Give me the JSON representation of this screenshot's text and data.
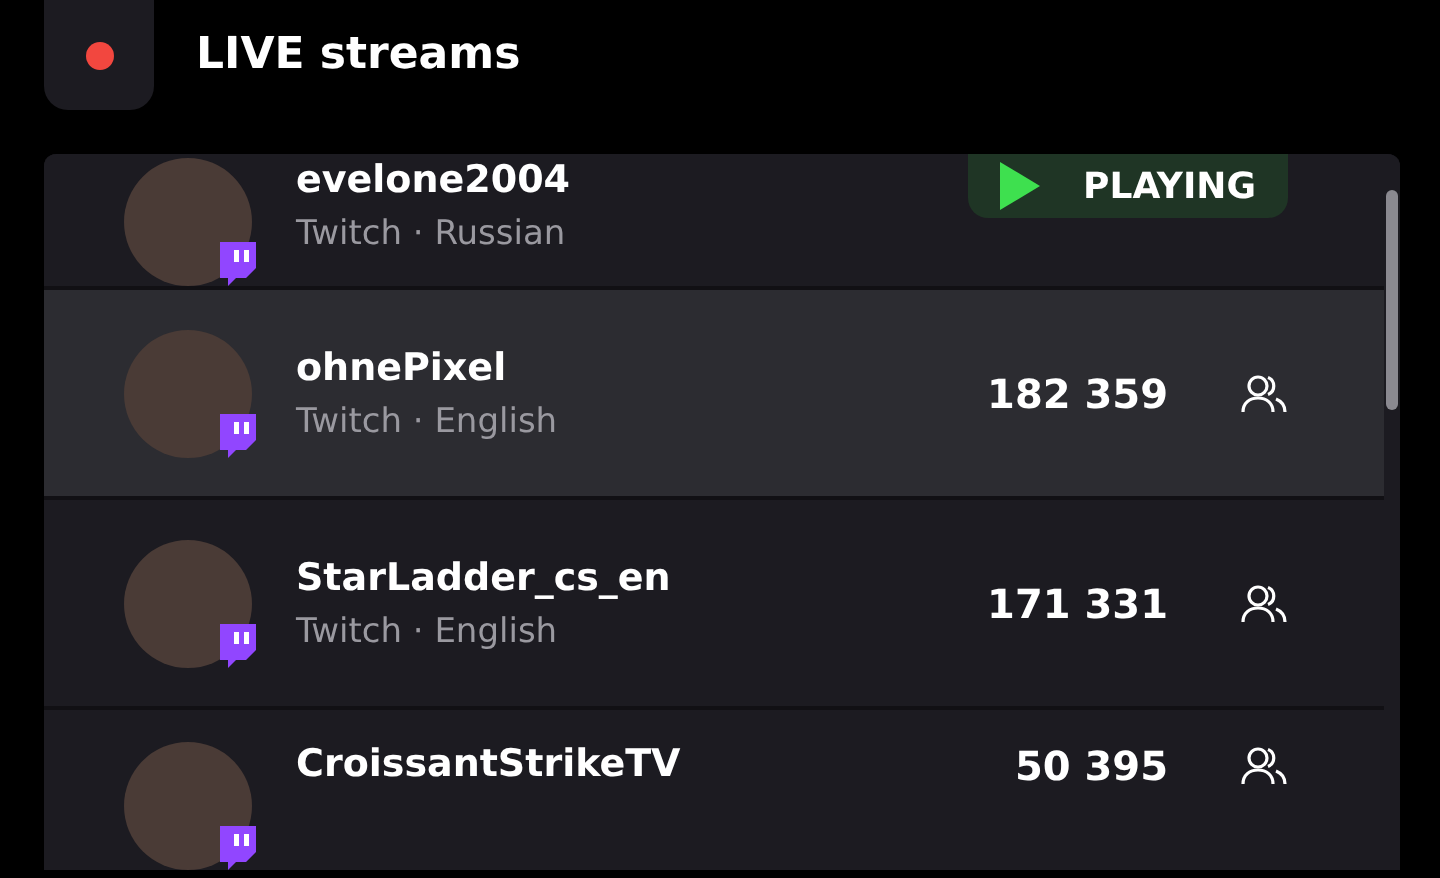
{
  "header": {
    "title": "LIVE streams"
  },
  "streams": [
    {
      "kind": "playing",
      "name": "evelone2004",
      "subtitle": "Twitch · Russian",
      "status": "PLAYING",
      "selected": false
    },
    {
      "kind": "viewers",
      "name": "ohnePixel",
      "subtitle": "Twitch · English",
      "viewers": "182 359",
      "selected": true
    },
    {
      "kind": "viewers",
      "name": "StarLadder_cs_en",
      "subtitle": "Twitch · English",
      "viewers": "171 331",
      "selected": false
    },
    {
      "kind": "viewers",
      "name": "CroissantStrikeTV",
      "viewers": "50 395",
      "selected": false
    }
  ]
}
